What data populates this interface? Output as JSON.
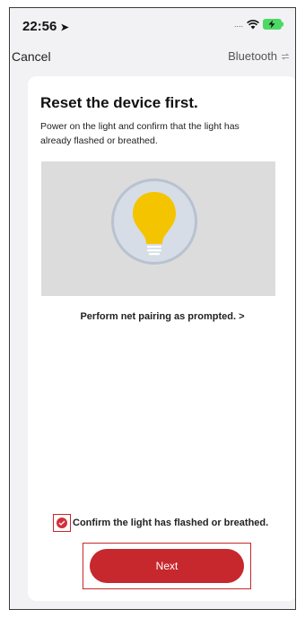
{
  "status_bar": {
    "time": "22:56",
    "location_icon": "location-arrow-icon",
    "signal_text": "....",
    "wifi_icon": "wifi-icon",
    "battery_icon": "battery-charging-icon"
  },
  "nav": {
    "cancel_label": "Cancel",
    "mode_label": "Bluetooth",
    "mode_icon": "switch-arrows-icon"
  },
  "card": {
    "title": "Reset the device first.",
    "description": "Power on the light and confirm that the light has already flashed or breathed.",
    "illustration_icon": "lightbulb-icon",
    "prompt_link": "Perform net pairing as prompted. >",
    "confirm_label": "Confirm the light has flashed or breathed.",
    "confirm_checked": true,
    "next_label": "Next"
  },
  "colors": {
    "accent": "#c6282e",
    "bulb_yellow": "#f5c400",
    "card_bg": "#ffffff",
    "page_bg": "#f2f2f4"
  }
}
